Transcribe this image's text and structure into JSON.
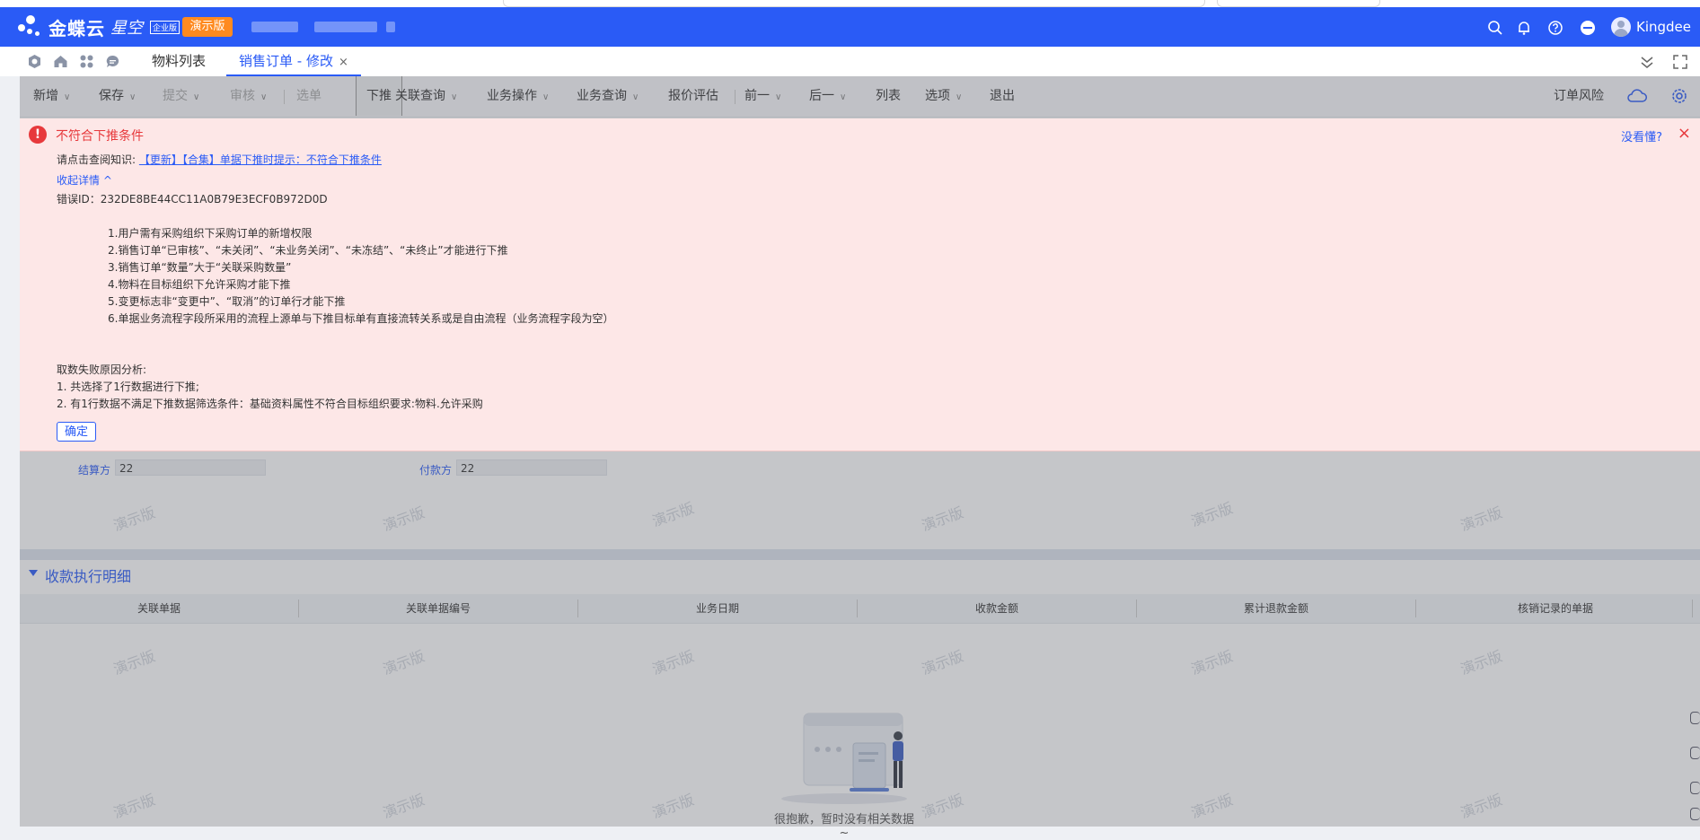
{
  "header": {
    "brand": "金蝶云",
    "product": "星空",
    "edition": "企业版",
    "demo_badge": "演示版",
    "user_name": "Kingdee"
  },
  "tabs": [
    {
      "label": "物料列表"
    },
    {
      "label": "销售订单 - 修改",
      "close": "×"
    }
  ],
  "toolbar": {
    "items": [
      "新增",
      "保存",
      "提交",
      "审核",
      "选单",
      "下推",
      "关联查询",
      "业务操作",
      "业务查询",
      "报价评估",
      "前一",
      "后一",
      "列表",
      "选项",
      "退出"
    ],
    "right_label": "订单风险"
  },
  "fields": {
    "settle_label": "结算方",
    "settle_value": "22",
    "payer_label": "付款方",
    "payer_value": "22"
  },
  "section": {
    "title": "收款执行明细",
    "columns": [
      "关联单据",
      "关联单据编号",
      "业务日期",
      "收款金额",
      "累计退款金额",
      "核销记录的单据"
    ],
    "empty_text": "很抱歉，暂时没有相关数据~"
  },
  "watermark": "演示版",
  "alert": {
    "title": "不符合下推条件",
    "help": "没看懂?",
    "close": "×",
    "kb_prefix": "请点击查阅知识:",
    "kb_link": "【更新】【合集】单据下推时提示：不符合下推条件",
    "toggle": "收起详情 ^",
    "error_id": "错误ID：232DE8BE44CC11A0B79E3ECF0B972D0D",
    "conditions": [
      "1.用户需有采购组织下采购订单的新增权限",
      "2.销售订单“已审核”、“未关闭”、“未业务关闭”、“未冻结”、“未终止”才能进行下推",
      "3.销售订单“数量”大于“关联采购数量”",
      "4.物料在目标组织下允许采购才能下推",
      "5.变更标志非“变更中”、“取消”的订单行才能下推",
      "6.单据业务流程字段所采用的流程上源单与下推目标单有直接流转关系或是自由流程（业务流程字段为空）"
    ],
    "analysis_title": "取数失败原因分析:",
    "analysis": [
      "1. 共选择了1行数据进行下推;",
      "2. 有1行数据不满足下推数据筛选条件：基础资料属性不符合目标组织要求:物料.允许采购"
    ],
    "ok": "确定"
  }
}
